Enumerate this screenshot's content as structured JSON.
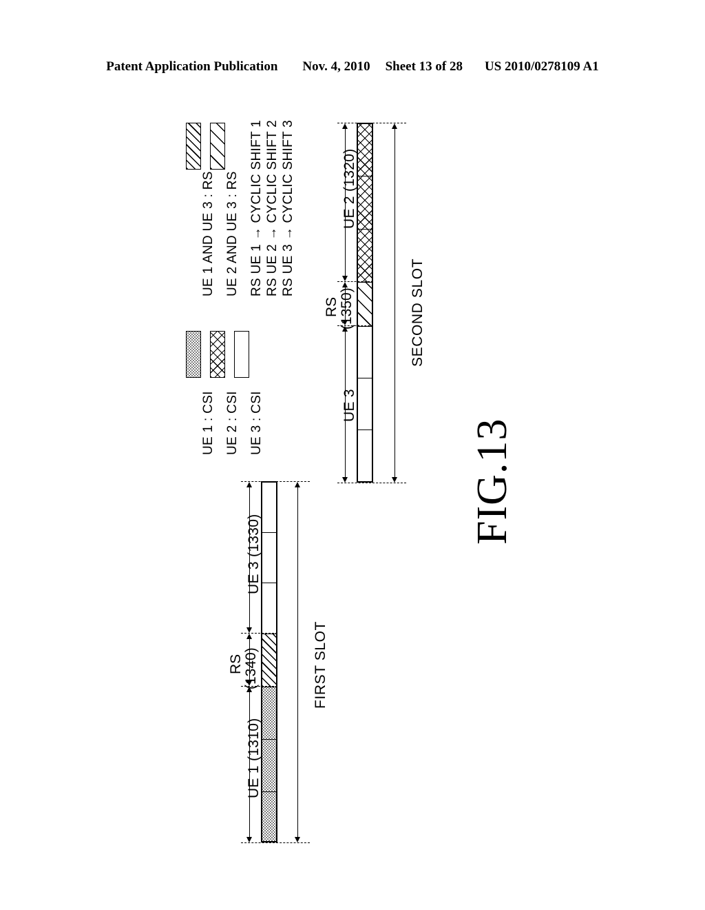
{
  "header": {
    "publication": "Patent Application Publication",
    "date": "Nov. 4, 2010",
    "sheet": "Sheet 13 of 28",
    "docnum": "US 2010/0278109 A1"
  },
  "figure": {
    "label": "FIG.13"
  },
  "legend": {
    "csi": [
      {
        "label": "UE 1 : CSI",
        "fill": "dotted"
      },
      {
        "label": "UE 2 : CSI",
        "fill": "crosshatch"
      },
      {
        "label": "UE 3 : CSI",
        "fill": "white"
      }
    ],
    "rs": [
      {
        "label": "UE 1 AND UE 3 : RS",
        "fill": "hatch-dense"
      },
      {
        "label": "UE 2 AND UE 3 : RS",
        "fill": "hatch-sparse"
      }
    ],
    "notes": [
      "RS UE 1 → CYCLIC SHIFT 1",
      "RS UE 2 → CYCLIC SHIFT 2",
      "RS UE 3 → CYCLIC SHIFT 3"
    ]
  },
  "first_slot": {
    "axis_label": "FIRST SLOT",
    "regions": [
      {
        "name": "UE 1 (1310)",
        "fill": "dotted",
        "segments": 3
      },
      {
        "name": "RS\n(1340)",
        "label_line1": "RS",
        "label_line2": "(1340)",
        "fill": "hatch-dense",
        "segments": 1
      },
      {
        "name": "UE 3 (1330)",
        "fill": "white",
        "segments": 3
      }
    ],
    "ue1_label": "UE 1 (1310)",
    "rs_label_line1": "RS",
    "rs_label_line2": "(1340)",
    "ue3_label": "UE 3 (1330)"
  },
  "second_slot": {
    "axis_label": "SECOND SLOT",
    "ue3_label": "UE 3",
    "rs_label_line1": "RS",
    "rs_label_line2": "(1350)",
    "ue2_label": "UE 2 (1320)",
    "regions": [
      {
        "name": "UE 3",
        "fill": "white",
        "segments": 3
      },
      {
        "name": "RS (1350)",
        "fill": "hatch-sparse",
        "segments": 1
      },
      {
        "name": "UE 2 (1320)",
        "fill": "crosshatch",
        "segments": 3
      }
    ]
  },
  "colors": {
    "ink": "#000000",
    "paper": "#ffffff"
  }
}
